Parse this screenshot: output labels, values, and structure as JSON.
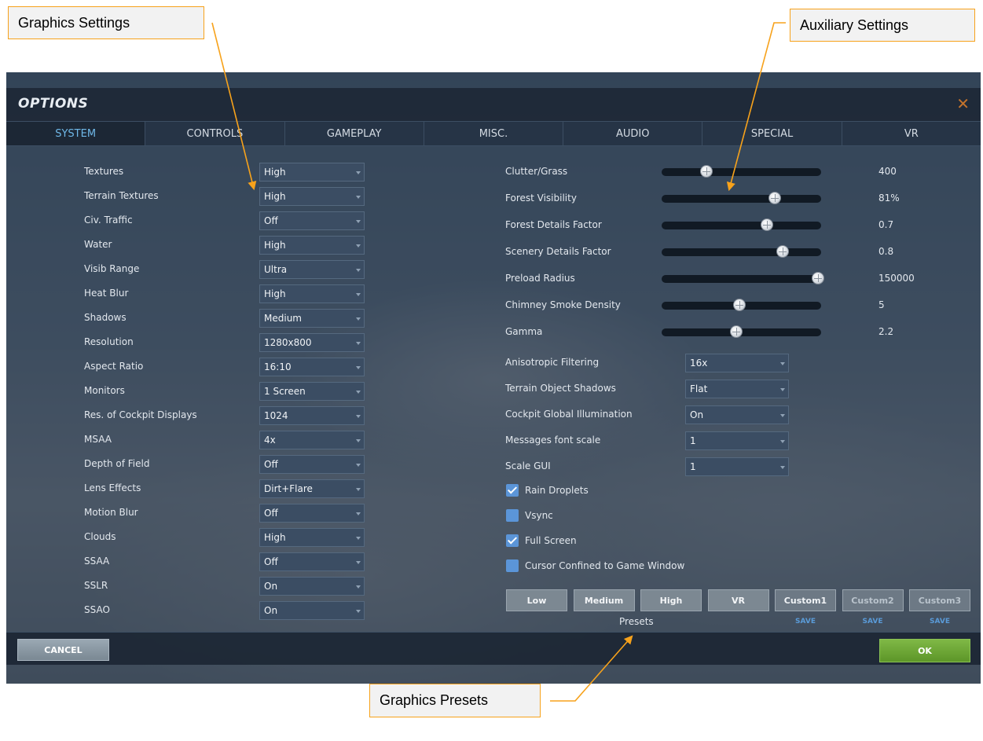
{
  "annotations": {
    "graphics_settings": "Graphics Settings",
    "auxiliary_settings": "Auxiliary Settings",
    "graphics_presets": "Graphics Presets",
    "accent_color": "#f7a21b"
  },
  "window": {
    "title": "OPTIONS",
    "close_icon": "close-icon"
  },
  "tabs": [
    {
      "label": "SYSTEM",
      "active": true
    },
    {
      "label": "CONTROLS",
      "active": false
    },
    {
      "label": "GAMEPLAY",
      "active": false
    },
    {
      "label": "MISC.",
      "active": false
    },
    {
      "label": "AUDIO",
      "active": false
    },
    {
      "label": "SPECIAL",
      "active": false
    },
    {
      "label": "VR",
      "active": false
    }
  ],
  "graphics": [
    {
      "label": "Textures",
      "value": "High"
    },
    {
      "label": "Terrain Textures",
      "value": "High"
    },
    {
      "label": "Civ. Traffic",
      "value": "Off"
    },
    {
      "label": "Water",
      "value": "High"
    },
    {
      "label": "Visib Range",
      "value": "Ultra"
    },
    {
      "label": "Heat Blur",
      "value": "High"
    },
    {
      "label": "Shadows",
      "value": "Medium"
    },
    {
      "label": "Resolution",
      "value": "1280x800"
    },
    {
      "label": "Aspect Ratio",
      "value": "16:10"
    },
    {
      "label": "Monitors",
      "value": "1 Screen"
    },
    {
      "label": "Res. of Cockpit Displays",
      "value": "1024"
    },
    {
      "label": "MSAA",
      "value": "4x"
    },
    {
      "label": "Depth of Field",
      "value": "Off"
    },
    {
      "label": "Lens Effects",
      "value": "Dirt+Flare"
    },
    {
      "label": "Motion Blur",
      "value": "Off"
    },
    {
      "label": "Clouds",
      "value": "High"
    },
    {
      "label": "SSAA",
      "value": "Off"
    },
    {
      "label": "SSLR",
      "value": "On"
    },
    {
      "label": "SSAO",
      "value": "On"
    }
  ],
  "sliders": [
    {
      "label": "Clutter/Grass",
      "value": "400",
      "fraction": 0.28
    },
    {
      "label": "Forest Visibility",
      "value": "81%",
      "fraction": 0.71
    },
    {
      "label": "Forest Details Factor",
      "value": "0.7",
      "fraction": 0.66
    },
    {
      "label": "Scenery Details Factor",
      "value": "0.8",
      "fraction": 0.76
    },
    {
      "label": "Preload Radius",
      "value": "150000",
      "fraction": 0.98
    },
    {
      "label": "Chimney Smoke Density",
      "value": "5",
      "fraction": 0.49
    },
    {
      "label": "Gamma",
      "value": "2.2",
      "fraction": 0.47
    }
  ],
  "aux_dropdowns": [
    {
      "label": "Anisotropic Filtering",
      "value": "16x"
    },
    {
      "label": "Terrain Object Shadows",
      "value": "Flat"
    },
    {
      "label": "Cockpit Global Illumination",
      "value": "On"
    },
    {
      "label": "Messages font scale",
      "value": "1"
    },
    {
      "label": "Scale GUI",
      "value": "1"
    }
  ],
  "checkboxes": [
    {
      "label": "Rain Droplets",
      "checked": true
    },
    {
      "label": "Vsync",
      "checked": false
    },
    {
      "label": "Full Screen",
      "checked": true
    },
    {
      "label": "Cursor Confined to Game Window",
      "checked": false
    }
  ],
  "presets": {
    "label": "Presets",
    "buttons": [
      "Low",
      "Medium",
      "High",
      "VR"
    ],
    "custom": [
      "Custom1",
      "Custom2",
      "Custom3"
    ],
    "save_label": "SAVE"
  },
  "footer": {
    "cancel": "CANCEL",
    "ok": "OK",
    "ok_color": "#6aa536"
  }
}
